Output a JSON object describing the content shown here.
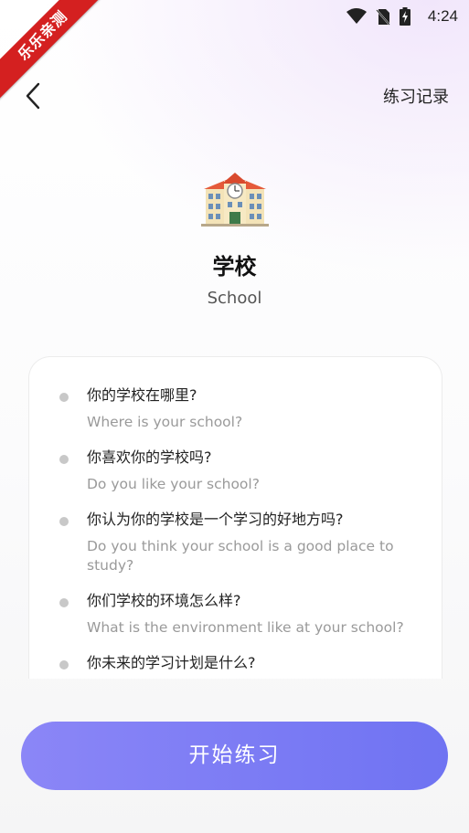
{
  "status_bar": {
    "time": "4:24"
  },
  "watermark": {
    "text": "乐乐亲测"
  },
  "header": {
    "history_label": "练习记录"
  },
  "topic": {
    "icon": "school-building-icon",
    "title": "学校",
    "subtitle": "School"
  },
  "questions": [
    {
      "zh": "你的学校在哪里?",
      "en": "Where is your school?"
    },
    {
      "zh": "你喜欢你的学校吗?",
      "en": "Do you like your school?"
    },
    {
      "zh": "你认为你的学校是一个学习的好地方吗?",
      "en": "Do you think your school is a good place to study?"
    },
    {
      "zh": "你们学校的环境怎么样?",
      "en": "What is the environment like at your school?"
    },
    {
      "zh": "你未来的学习计划是什么?",
      "en": ""
    }
  ],
  "actions": {
    "start_label": "开始练习"
  },
  "colors": {
    "accent_start": "#8b86f7",
    "accent_end": "#6f73f2",
    "watermark_red": "#d42020"
  }
}
